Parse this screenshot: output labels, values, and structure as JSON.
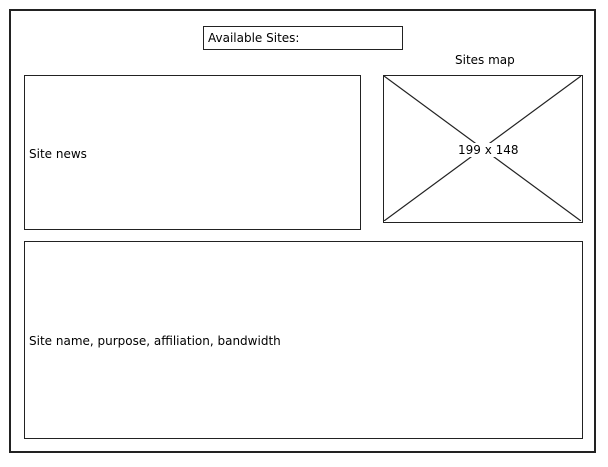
{
  "sites_selector": {
    "label": "Available Sites:"
  },
  "news": {
    "label": "Site news"
  },
  "map": {
    "title": "Sites map",
    "placeholder": "199 x 148"
  },
  "sites_table": {
    "label": "Site name, purpose, affiliation, bandwidth"
  }
}
